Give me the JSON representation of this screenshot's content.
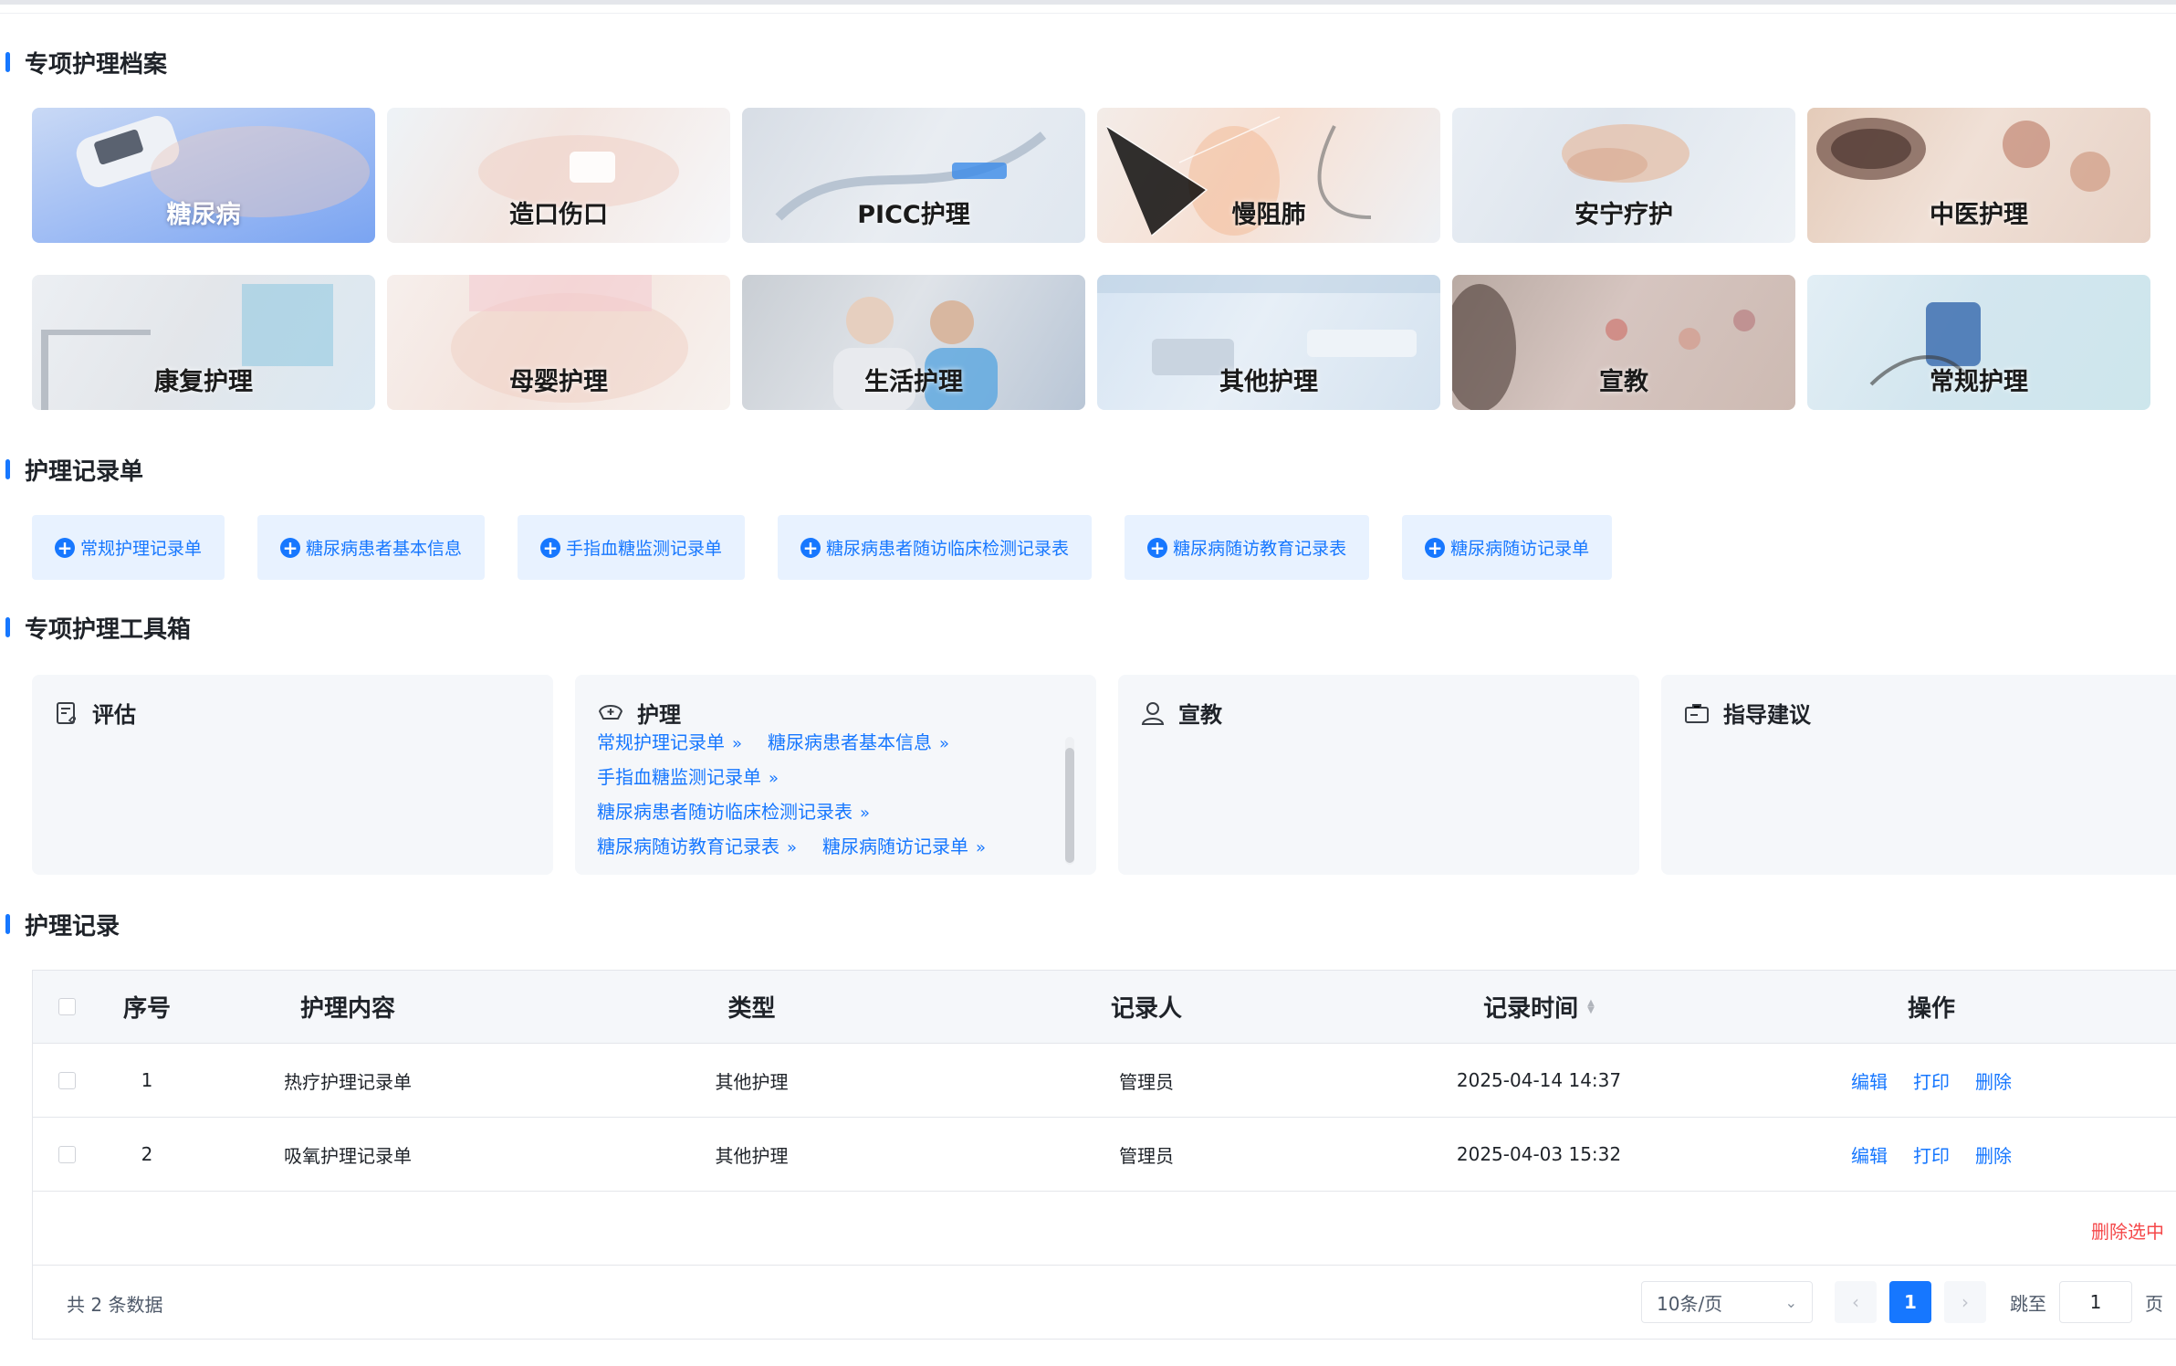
{
  "sections": {
    "archive": "专项护理档案",
    "records_form": "护理记录单",
    "toolbox": "专项护理工具箱",
    "records": "护理记录"
  },
  "cards": [
    {
      "label": "糖尿病",
      "active": true
    },
    {
      "label": "造口伤口"
    },
    {
      "label": "PICC护理"
    },
    {
      "label": "慢阻肺"
    },
    {
      "label": "安宁疗护"
    },
    {
      "label": "中医护理"
    },
    {
      "label": "康复护理"
    },
    {
      "label": "母婴护理"
    },
    {
      "label": "生活护理"
    },
    {
      "label": "其他护理"
    },
    {
      "label": "宣教"
    },
    {
      "label": "常规护理"
    }
  ],
  "record_buttons": [
    "常规护理记录单",
    "糖尿病患者基本信息",
    "手指血糖监测记录单",
    "糖尿病患者随访临床检测记录表",
    "糖尿病随访教育记录表",
    "糖尿病随访记录单"
  ],
  "tools": [
    {
      "title": "评估",
      "icon": "clipboard-heart-icon"
    },
    {
      "title": "护理",
      "icon": "nurse-cap-icon",
      "links": [
        [
          "常规护理记录单",
          "糖尿病患者基本信息"
        ],
        [
          "手指血糖监测记录单"
        ],
        [
          "糖尿病患者随访临床检测记录表"
        ],
        [
          "糖尿病随访教育记录表",
          "糖尿病随访记录单"
        ]
      ]
    },
    {
      "title": "宣教",
      "icon": "person-icon"
    },
    {
      "title": "指导建议",
      "icon": "briefcase-icon"
    }
  ],
  "table": {
    "headers": {
      "index": "序号",
      "content": "护理内容",
      "type": "类型",
      "recorder": "记录人",
      "time": "记录时间",
      "ops": "操作"
    },
    "rows": [
      {
        "index": "1",
        "content": "热疗护理记录单",
        "type": "其他护理",
        "recorder": "管理员",
        "time": "2025-04-14 14:37"
      },
      {
        "index": "2",
        "content": "吸氧护理记录单",
        "type": "其他护理",
        "recorder": "管理员",
        "time": "2025-04-03 15:32"
      }
    ],
    "ops": {
      "edit": "编辑",
      "print": "打印",
      "delete": "删除"
    },
    "delete_selected": "删除选中"
  },
  "pagination": {
    "total": "共 2 条数据",
    "page_size": "10条/页",
    "current_page": "1",
    "jump_label": "跳至",
    "jump_value": "1",
    "page_unit": "页"
  },
  "colors": {
    "accent": "#1677ff",
    "danger": "#f5484a"
  }
}
